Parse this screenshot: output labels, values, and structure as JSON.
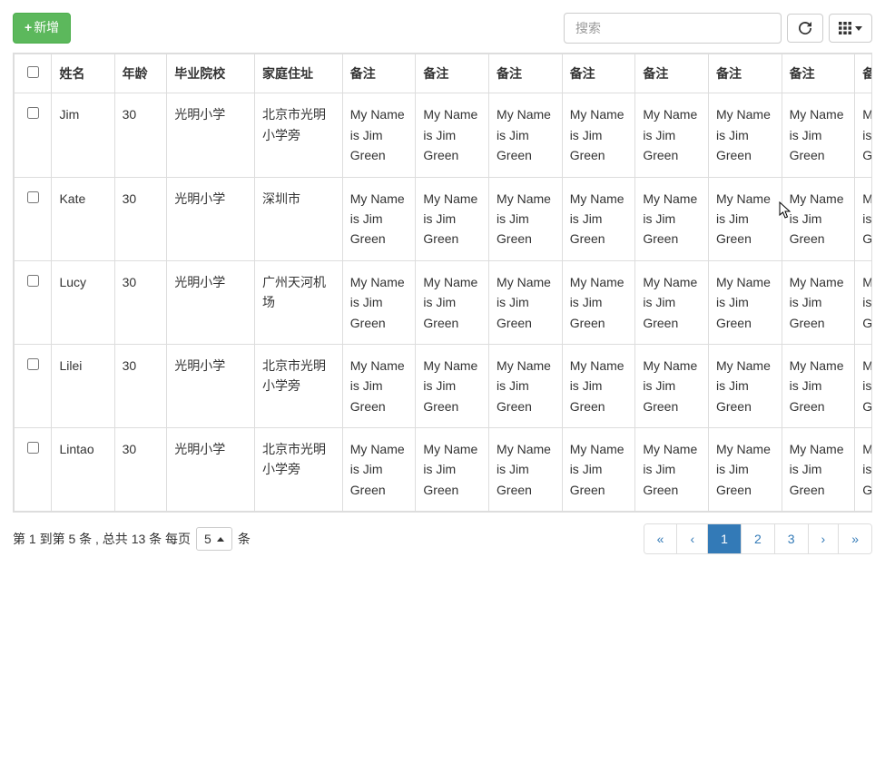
{
  "toolbar": {
    "add_label": "新增",
    "search_placeholder": "搜索"
  },
  "columns": {
    "checkbox": "",
    "name": "姓名",
    "age": "年龄",
    "school": "毕业院校",
    "address": "家庭住址",
    "note": "备注"
  },
  "note_value": "My Name is Jim Green",
  "rows": [
    {
      "name": "Jim",
      "age": "30",
      "school": "光明小学",
      "address": "北京市光明小学旁"
    },
    {
      "name": "Kate",
      "age": "30",
      "school": "光明小学",
      "address": "深圳市"
    },
    {
      "name": "Lucy",
      "age": "30",
      "school": "光明小学",
      "address": "广州天河机场"
    },
    {
      "name": "Lilei",
      "age": "30",
      "school": "光明小学",
      "address": "北京市光明小学旁"
    },
    {
      "name": "Lintao",
      "age": "30",
      "school": "光明小学",
      "address": "北京市光明小学旁"
    }
  ],
  "footer": {
    "info_prefix": "第 1 到第 5 条 , 总共 13 条 每页",
    "page_size": "5",
    "info_suffix": "条"
  },
  "pagination": {
    "first": "«",
    "prev": "‹",
    "pages": [
      "1",
      "2",
      "3"
    ],
    "active": "1",
    "next": "›",
    "last": "»"
  }
}
